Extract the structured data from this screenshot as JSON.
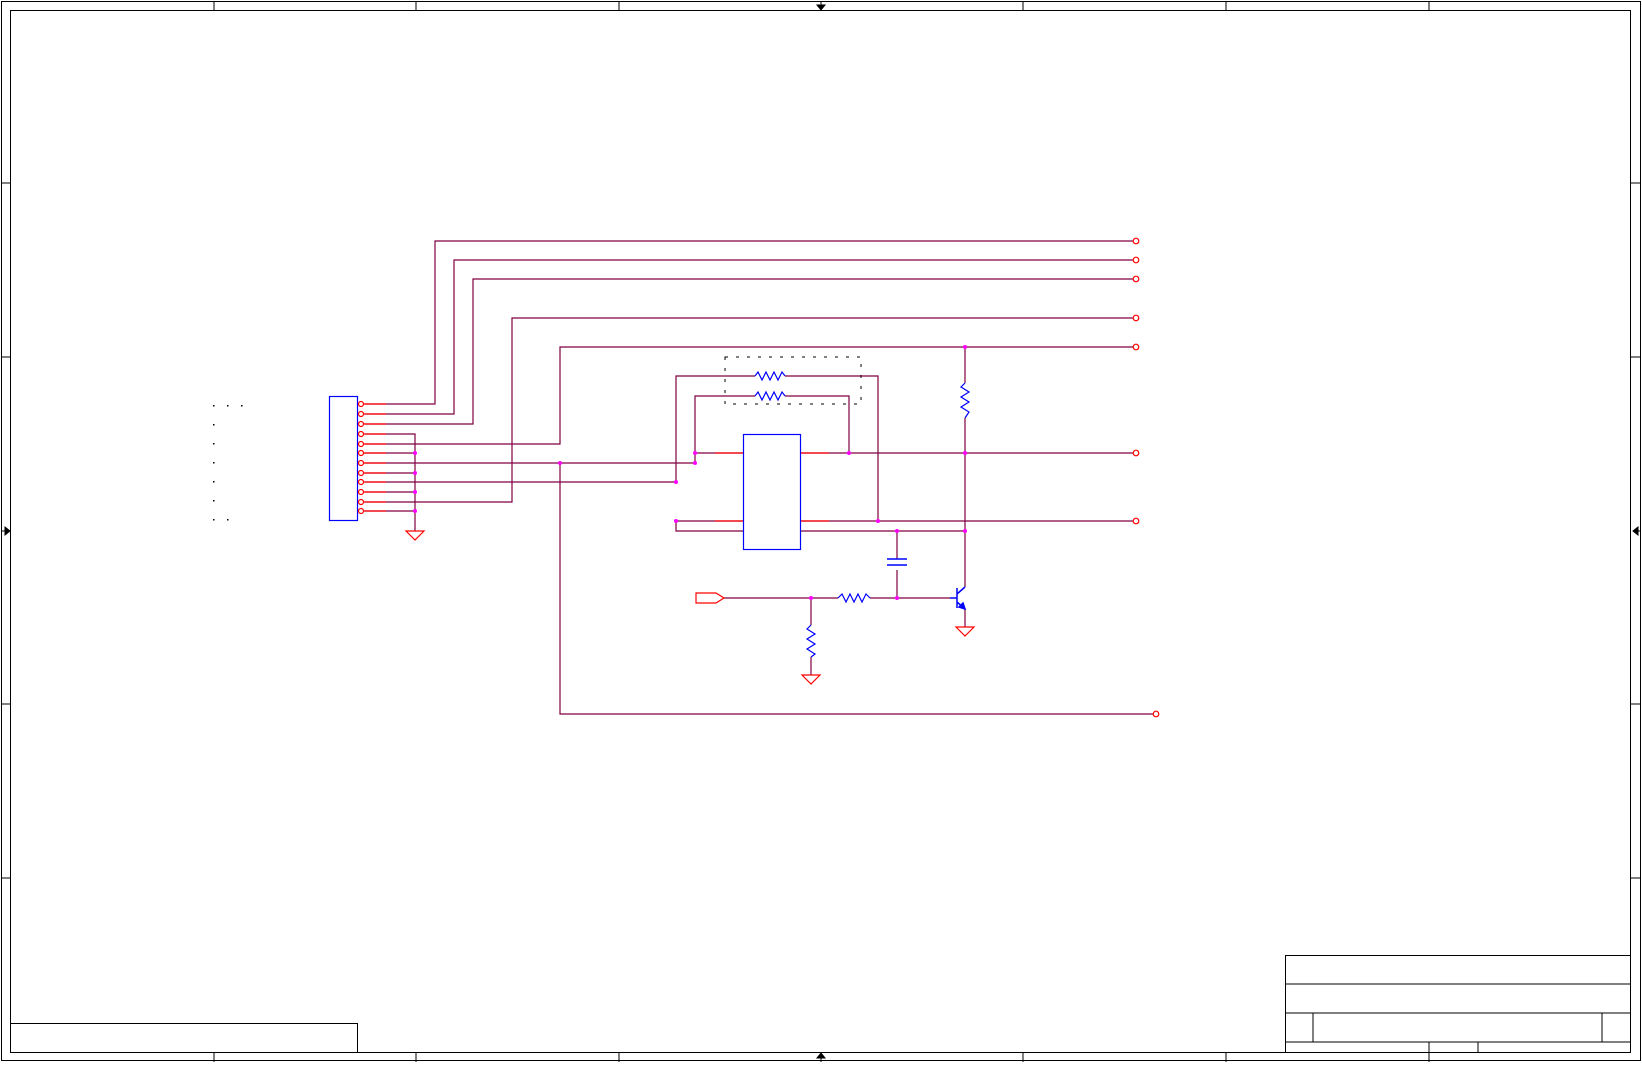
{
  "sheet": {
    "colors": {
      "border": "#000000",
      "wire": "#800040",
      "pin": "#ff0000",
      "part": "#0000ff",
      "junction": "#ff00ff",
      "dashed": "#000000"
    },
    "zone_labels_top": [],
    "zone_labels_side": []
  },
  "title_block": {
    "title": "",
    "doc_number": "",
    "revision": "",
    "size": "",
    "sheet": "",
    "date": ""
  },
  "notes_box": {
    "text": ""
  }
}
